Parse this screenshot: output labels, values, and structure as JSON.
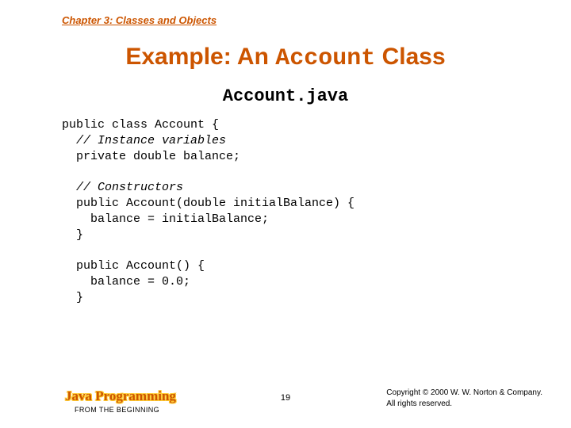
{
  "chapter": "Chapter 3: Classes and Objects",
  "title": {
    "pre": "Example: An ",
    "mono": "Account",
    "post": " Class"
  },
  "subtitle": "Account.java",
  "code": {
    "l1": "public class Account {",
    "l2": "  // Instance variables",
    "l3": "  private double balance;",
    "l4": "",
    "l5": "  // Constructors",
    "l6": "  public Account(double initialBalance) {",
    "l7": "    balance = initialBalance;",
    "l8": "  }",
    "l9": "",
    "l10": "  public Account() {",
    "l11": "    balance = 0.0;",
    "l12": "  }"
  },
  "footer": {
    "brand": "Java Programming",
    "brand_sub": "FROM THE BEGINNING",
    "page": "19",
    "copy1": "Copyright © 2000 W. W. Norton & Company.",
    "copy2": "All rights reserved."
  }
}
